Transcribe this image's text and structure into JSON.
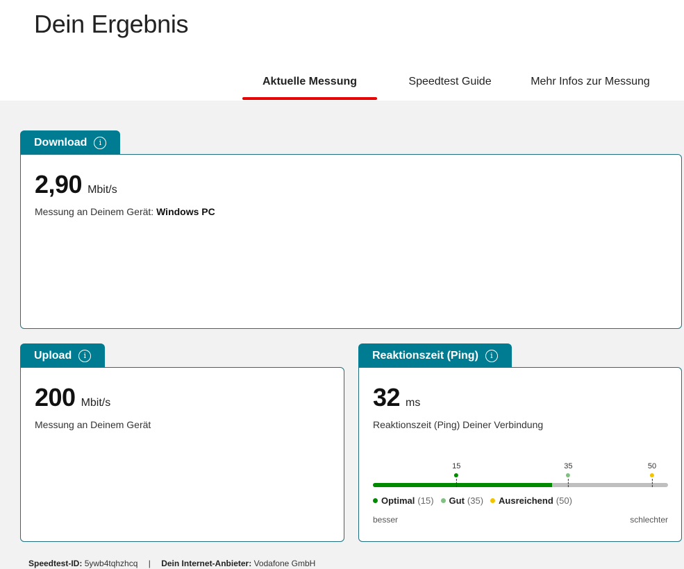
{
  "header": {
    "title": "Dein Ergebnis"
  },
  "tabs": [
    {
      "label": "Aktuelle Messung",
      "active": true
    },
    {
      "label": "Speedtest Guide",
      "active": false
    },
    {
      "label": "Mehr Infos zur Messung",
      "active": false
    }
  ],
  "download": {
    "tab_label": "Download",
    "value": "2,90",
    "unit": "Mbit/s",
    "sub_prefix": "Messung an Deinem Gerät:",
    "device": "Windows PC"
  },
  "upload": {
    "tab_label": "Upload",
    "value": "200",
    "unit": "Mbit/s",
    "sub": "Messung an Deinem Gerät"
  },
  "ping": {
    "tab_label": "Reaktionszeit (Ping)",
    "value": "32",
    "unit": "ms",
    "sub": "Reaktionszeit (Ping) Deiner Verbindung",
    "fill_fraction": 0.607,
    "ticks": [
      {
        "label": "15",
        "color": "#008a00",
        "position": 0.283
      },
      {
        "label": "35",
        "color": "#7fc27f",
        "position": 0.662
      },
      {
        "label": "50",
        "color": "#f2c400",
        "position": 0.946
      }
    ],
    "legend": [
      {
        "name": "Optimal",
        "value": "(15)",
        "color": "#008a00"
      },
      {
        "name": "Gut",
        "value": "(35)",
        "color": "#7fc27f"
      },
      {
        "name": "Ausreichend",
        "value": "(50)",
        "color": "#f2c400"
      }
    ],
    "better_label": "besser",
    "worse_label": "schlechter"
  },
  "footer": {
    "id_label": "Speedtest-ID:",
    "id_value": "5ywb4tqhzhcq",
    "separator": "|",
    "provider_label": "Dein Internet-Anbieter:",
    "provider_value": "Vodafone GmbH"
  },
  "colors": {
    "accent": "#e60000",
    "card_tab": "#007c92"
  }
}
